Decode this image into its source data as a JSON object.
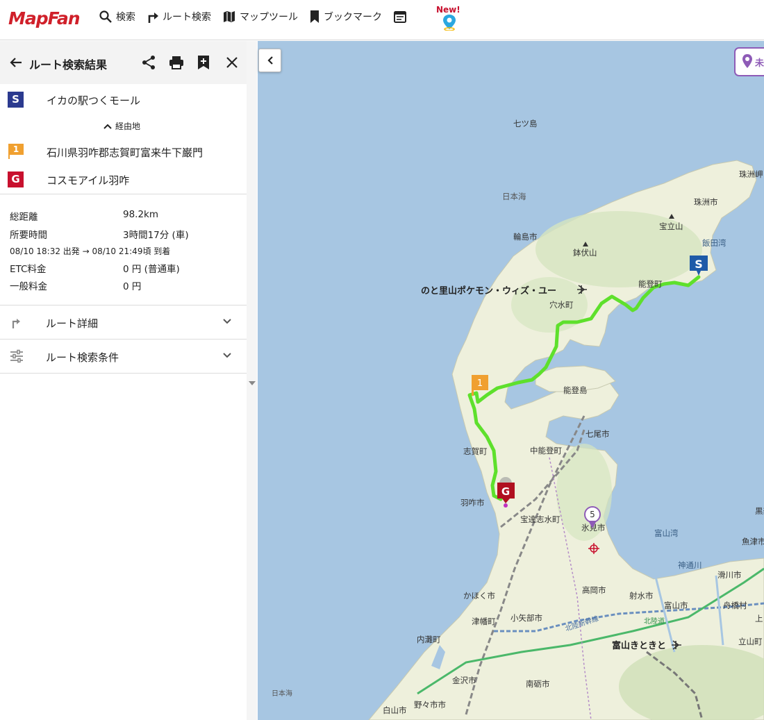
{
  "app": {
    "logo": "MapFan",
    "nav": [
      {
        "label": "検索",
        "icon": "search-icon"
      },
      {
        "label": "ルート検索",
        "icon": "route-icon"
      },
      {
        "label": "マップツール",
        "icon": "map-icon"
      },
      {
        "label": "ブックマーク",
        "icon": "bookmark-icon"
      }
    ],
    "new_badge": "New!"
  },
  "panel": {
    "title": "ルート検索結果",
    "start": {
      "badge": "S",
      "label": "イカの駅つくモール"
    },
    "via_toggle": "経由地",
    "via": {
      "badge": "1",
      "label": "石川県羽咋郡志賀町富来牛下巌門"
    },
    "goal": {
      "badge": "G",
      "label": "コスモアイル羽咋"
    },
    "summary": {
      "distance_label": "総距離",
      "distance_value": "98.2km",
      "time_label": "所要時間",
      "time_value": "3時間17分 (車)",
      "schedule": "08/10 18:32 出発 → 08/10 21:49頃 到着",
      "etc_label": "ETC料金",
      "etc_value": "0 円 (普通車)",
      "toll_label": "一般料金",
      "toll_value": "0 円"
    },
    "sections": [
      {
        "label": "ルート詳細",
        "icon": "route-detail-icon"
      },
      {
        "label": "ルート検索条件",
        "icon": "settings-sliders-icon"
      }
    ],
    "colors": {
      "start_badge": "#2b3a8f",
      "via_badge": "#f0a030",
      "goal_badge": "#c8102e",
      "route": "#5ee02c"
    }
  },
  "map": {
    "chip_text": "未",
    "labels": {
      "nanatsujima": "七ツ島",
      "nihonkai_n": "日本海",
      "suzu_misaki": "珠洲岬",
      "suzu": "珠洲市",
      "horyuzan": "宝立山",
      "iida": "飯田湾",
      "wajima": "輪島市",
      "hachibuse": "鉢伏山",
      "noto_airport": "のと里山ポケモン・ウィズ・ユー",
      "noto_town": "能登町",
      "anamizu": "穴水町",
      "notojima": "能登島",
      "nanao": "七尾市",
      "shika": "志賀町",
      "nakanoto": "中能登町",
      "hakui": "羽咋市",
      "hodatsushimizu": "宝達志水町",
      "himi": "氷見市",
      "toyamawan": "富山湾",
      "kurobe": "黒部",
      "uozu": "魚津市",
      "jinzu": "神通川",
      "namerikawa": "滑川市",
      "kahoku": "かほく市",
      "takaoka": "高岡市",
      "imizu": "射水市",
      "toyama": "富山市",
      "funahashi": "舟橋村",
      "tsubata": "津幡町",
      "oyabe": "小矢部市",
      "uchinada": "内灘町",
      "shinkansen": "北陸新幹線",
      "hokuriku_road": "北陸道",
      "toyama_airport": "富山きときと",
      "tateyama": "立山町",
      "kamiichi": "上",
      "kanazawa": "金沢市",
      "tonami": "南砺市",
      "nihonkai_s": "日本海",
      "hakusan": "白山市",
      "nonoichi": "野々市市",
      "pin_s": "S",
      "pin_1": "1",
      "pin_g": "G",
      "pin_5": "5"
    }
  }
}
